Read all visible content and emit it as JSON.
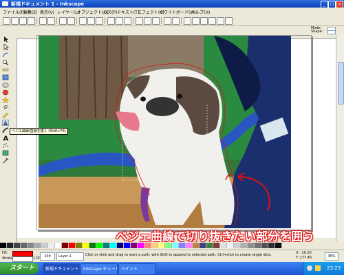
{
  "titlebar": {
    "title": "新規ドキュメント 1 - Inkscape"
  },
  "menubar": {
    "items": [
      "ファイル(F)",
      "編集(E)",
      "表示(V)",
      "レイヤー(L)",
      "オブジェクト(O)",
      "パス(P)",
      "テキスト(T)",
      "エフェクト(C)",
      "ホワイトボード(W)",
      "ヘルプ(H)"
    ]
  },
  "ctrlbar": {
    "right_label_1": "Mode:",
    "right_label_2": "Shape:"
  },
  "tooltip": {
    "text": "ベジエ曲線/直線を描く (Shift+F6)"
  },
  "annotation": {
    "text": "ベジェ曲線で切り抜きたい部分を囲う"
  },
  "statusbar": {
    "fill_label": "Fill:",
    "stroke_label": "Stroke:",
    "stroke_width": "1.00",
    "opacity_value": "100",
    "layer_name": "Layer 1",
    "message": "Click or click and drag to start a path; with Shift to append to selected path. Ctrl+click to create single dots.",
    "x_coord": "X: -10.20",
    "y_coord": "Y: 177.45",
    "zoom": "35%"
  },
  "taskbar": {
    "start_label": "スタート",
    "tasks": [
      "新規ドキュメント 1 - ...",
      "Inkscape チュートリ...",
      "ペイント"
    ],
    "clock": "23:23"
  },
  "colors": {
    "accent": "#e01010",
    "titlebar": "#0a3fb8",
    "fill_indicator": "#ff0000"
  }
}
